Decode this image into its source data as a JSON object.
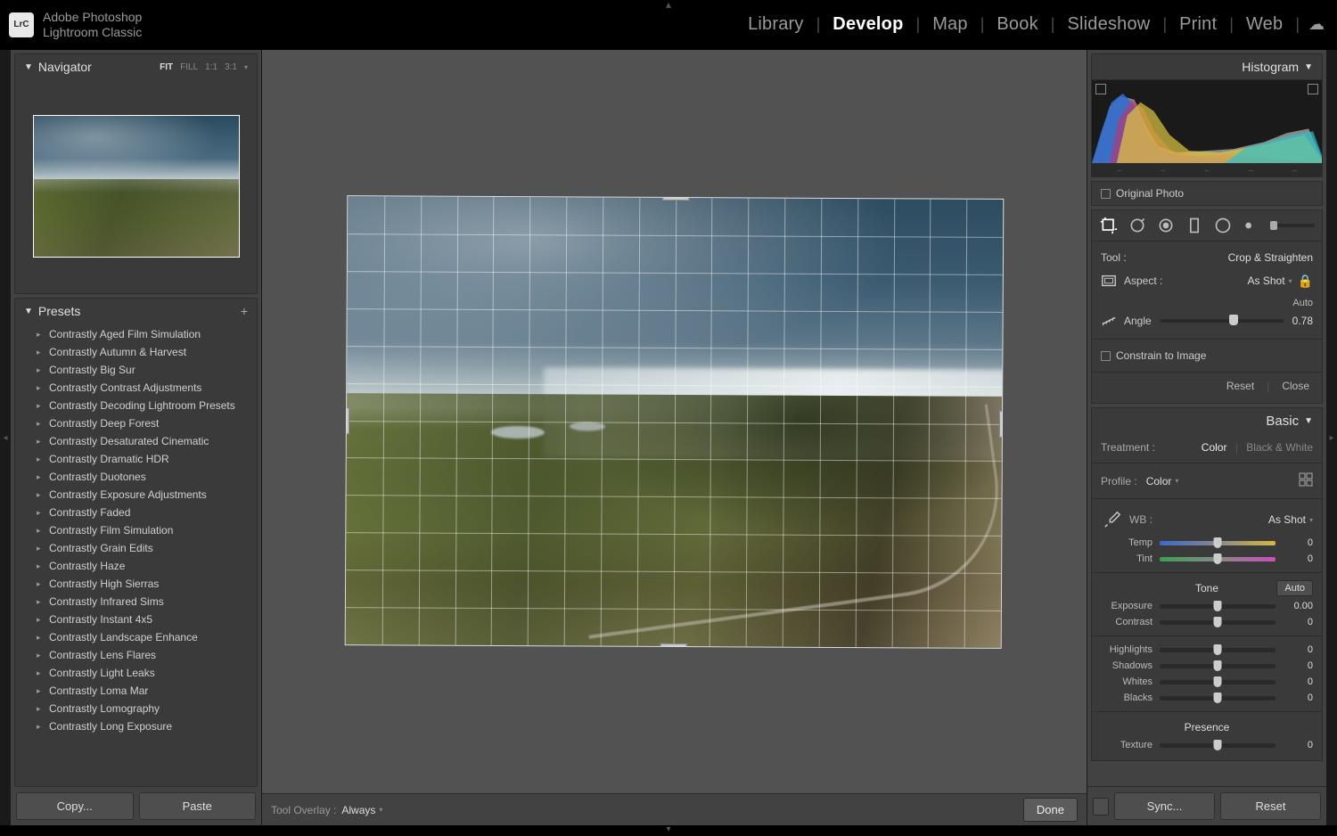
{
  "app": {
    "line1": "Adobe Photoshop",
    "line2": "Lightroom Classic",
    "logo": "LrC"
  },
  "modules": [
    "Library",
    "Develop",
    "Map",
    "Book",
    "Slideshow",
    "Print",
    "Web"
  ],
  "active_module": "Develop",
  "left": {
    "navigator": {
      "title": "Navigator",
      "zoom_options": [
        "FIT",
        "FILL",
        "1:1",
        "3:1"
      ],
      "zoom_selected": "FIT"
    },
    "presets": {
      "title": "Presets",
      "items": [
        "Contrastly Aged Film Simulation",
        "Contrastly Autumn & Harvest",
        "Contrastly Big Sur",
        "Contrastly Contrast Adjustments",
        "Contrastly Decoding Lightroom Presets",
        "Contrastly Deep Forest",
        "Contrastly Desaturated Cinematic",
        "Contrastly Dramatic HDR",
        "Contrastly Duotones",
        "Contrastly Exposure Adjustments",
        "Contrastly Faded",
        "Contrastly Film Simulation",
        "Contrastly Grain Edits",
        "Contrastly Haze",
        "Contrastly High Sierras",
        "Contrastly Infrared Sims",
        "Contrastly Instant 4x5",
        "Contrastly Landscape Enhance",
        "Contrastly Lens Flares",
        "Contrastly Light Leaks",
        "Contrastly Loma Mar",
        "Contrastly Lomography",
        "Contrastly Long Exposure"
      ]
    },
    "buttons": {
      "copy": "Copy...",
      "paste": "Paste"
    }
  },
  "center": {
    "tool_overlay_label": "Tool Overlay :",
    "tool_overlay_value": "Always",
    "done": "Done"
  },
  "right": {
    "histogram": {
      "title": "Histogram"
    },
    "original_photo": "Original Photo",
    "tool": {
      "label": "Tool :",
      "name": "Crop & Straighten",
      "aspect_label": "Aspect :",
      "aspect_value": "As Shot",
      "angle_label": "Angle",
      "angle_auto": "Auto",
      "angle_value": "0.78",
      "constrain": "Constrain to Image",
      "reset": "Reset",
      "close": "Close"
    },
    "basic": {
      "title": "Basic",
      "treatment_label": "Treatment :",
      "treatment_color": "Color",
      "treatment_bw": "Black & White",
      "profile_label": "Profile :",
      "profile_value": "Color",
      "wb_label": "WB :",
      "wb_value": "As Shot",
      "sliders_wb": [
        {
          "label": "Temp",
          "value": "0",
          "track": "temp"
        },
        {
          "label": "Tint",
          "value": "0",
          "track": "tint"
        }
      ],
      "tone_label": "Tone",
      "tone_auto": "Auto",
      "sliders_tone": [
        {
          "label": "Exposure",
          "value": "0.00"
        },
        {
          "label": "Contrast",
          "value": "0"
        }
      ],
      "sliders_tone2": [
        {
          "label": "Highlights",
          "value": "0"
        },
        {
          "label": "Shadows",
          "value": "0"
        },
        {
          "label": "Whites",
          "value": "0"
        },
        {
          "label": "Blacks",
          "value": "0"
        }
      ],
      "presence_label": "Presence",
      "sliders_presence": [
        {
          "label": "Texture",
          "value": "0"
        }
      ]
    },
    "buttons": {
      "sync": "Sync...",
      "reset": "Reset"
    }
  }
}
